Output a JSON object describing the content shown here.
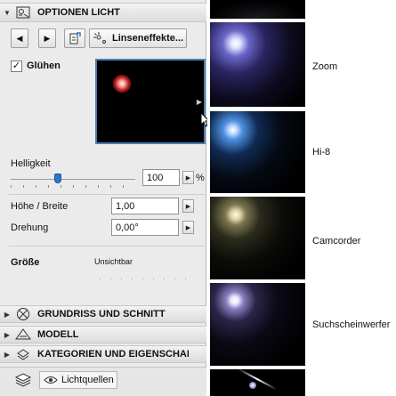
{
  "panel": {
    "header_light": {
      "title": "OPTIONEN LICHT"
    },
    "toolbar": {
      "lens_button_label": "Linseneffekte..."
    },
    "glow": {
      "checkbox_checked": true,
      "label": "Glühen"
    },
    "brightness": {
      "label": "Helligkeit",
      "value": "100",
      "unit": "%",
      "slider_fraction": 0.38
    },
    "height_width": {
      "label": "Höhe / Breite",
      "value": "1,00"
    },
    "rotation": {
      "label": "Drehung",
      "value": "0,00°"
    },
    "size": {
      "label": "Größe",
      "value": "Unsichtbar"
    },
    "sections": [
      {
        "title": "GRUNDRISS UND SCHNITT",
        "icon": "floor-plan-section-icon"
      },
      {
        "title": "MODELL",
        "icon": "model-icon"
      },
      {
        "title": "KATEGORIEN UND EIGENSCHAFTEN",
        "icon": "categories-icon"
      }
    ],
    "footer": {
      "label": "Lichtquellen"
    }
  },
  "gallery": {
    "items": [
      {
        "label": ""
      },
      {
        "label": "Zoom"
      },
      {
        "label": "Hi-8"
      },
      {
        "label": "Camcorder"
      },
      {
        "label": "Suchscheinwerfer"
      },
      {
        "label": ""
      }
    ]
  },
  "colors": {
    "panel_bg": "#ebebeb",
    "accent": "#2f76c9"
  }
}
